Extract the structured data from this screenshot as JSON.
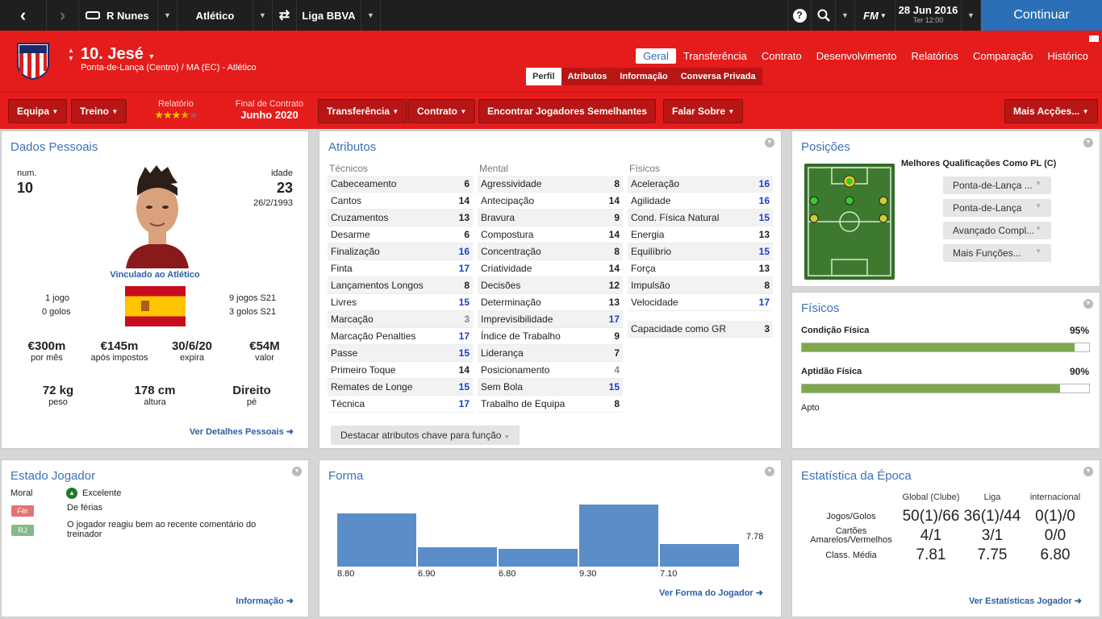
{
  "topbar": {
    "manager": "R Nunes",
    "club": "Atlético",
    "competition": "Liga BBVA",
    "fm": "FM",
    "date": "28 Jun 2016",
    "time": "Ter 12:00",
    "continue": "Continuar"
  },
  "header": {
    "name": "10. Jesé",
    "position": "Ponta-de-Lança (Centro) / MA (EC) - Atlético",
    "tabs": [
      "Geral",
      "Transferência",
      "Contrato",
      "Desenvolvimento",
      "Relatórios",
      "Comparação",
      "Histórico"
    ],
    "subtabs": [
      "Perfil",
      "Atributos",
      "Informação",
      "Conversa Privada"
    ]
  },
  "actions": {
    "equipa": "Equipa",
    "treino": "Treino",
    "relatorio_label": "Relatório",
    "relatorio_stars": "★★★★★",
    "contract_label": "Final de Contrato",
    "contract_value": "Junho 2020",
    "transferencia": "Transferência",
    "contrato": "Contrato",
    "semelhantes": "Encontrar Jogadores Semelhantes",
    "falar": "Falar Sobre",
    "mais": "Mais Acções..."
  },
  "personal": {
    "title": "Dados Pessoais",
    "num_label": "num.",
    "num": "10",
    "age_label": "idade",
    "age": "23",
    "dob": "26/2/1993",
    "loan": "Vinculado ao Atlético",
    "games": "1 jogo",
    "goals": "0 golos",
    "u21_games": "9 jogos S21",
    "u21_goals": "3 golos S21",
    "wage": "€300m",
    "wage_l": "por mês",
    "after_tax": "€145m",
    "after_tax_l": "após impostos",
    "expires": "30/6/20",
    "expires_l": "expira",
    "value": "€54M",
    "value_l": "valor",
    "weight": "72 kg",
    "weight_l": "peso",
    "height": "178 cm",
    "height_l": "altura",
    "foot": "Direito",
    "foot_l": "pé",
    "link": "Ver Detalhes Pessoais"
  },
  "attributes": {
    "title": "Atributos",
    "tech_h": "Técnicos",
    "mental_h": "Mental",
    "phys_h": "Físicos",
    "technical": [
      [
        "Cabeceamento",
        "6"
      ],
      [
        "Cantos",
        "14"
      ],
      [
        "Cruzamentos",
        "13"
      ],
      [
        "Desarme",
        "6"
      ],
      [
        "Finalização",
        "16"
      ],
      [
        "Finta",
        "17"
      ],
      [
        "Lançamentos Longos",
        "8"
      ],
      [
        "Livres",
        "15"
      ],
      [
        "Marcação",
        "3"
      ],
      [
        "Marcação Penalties",
        "17"
      ],
      [
        "Passe",
        "15"
      ],
      [
        "Primeiro Toque",
        "14"
      ],
      [
        "Remates de Longe",
        "15"
      ],
      [
        "Técnica",
        "17"
      ]
    ],
    "mental": [
      [
        "Agressividade",
        "8"
      ],
      [
        "Antecipação",
        "14"
      ],
      [
        "Bravura",
        "9"
      ],
      [
        "Compostura",
        "14"
      ],
      [
        "Concentração",
        "8"
      ],
      [
        "Criatividade",
        "14"
      ],
      [
        "Decisões",
        "12"
      ],
      [
        "Determinação",
        "13"
      ],
      [
        "Imprevisibilidade",
        "17"
      ],
      [
        "Índice de Trabalho",
        "9"
      ],
      [
        "Liderança",
        "7"
      ],
      [
        "Posicionamento",
        "4"
      ],
      [
        "Sem Bola",
        "15"
      ],
      [
        "Trabalho de Equipa",
        "8"
      ]
    ],
    "physical": [
      [
        "Aceleração",
        "16"
      ],
      [
        "Agilidade",
        "16"
      ],
      [
        "Cond. Física Natural",
        "15"
      ],
      [
        "Energia",
        "13"
      ],
      [
        "Equilíbrio",
        "15"
      ],
      [
        "Força",
        "13"
      ],
      [
        "Impulsão",
        "8"
      ],
      [
        "Velocidade",
        "17"
      ]
    ],
    "gk_label": "Capacidade como GR",
    "gk": "3",
    "highlight_btn": "Destacar atributos chave para função"
  },
  "positions": {
    "title": "Posições",
    "best": "Melhores Qualificações Como PL (C)",
    "roles": [
      "Ponta-de-Lança ...",
      "Ponta-de-Lança",
      "Avançado Compl...",
      "Mais Funções..."
    ]
  },
  "fitness": {
    "title": "Físicos",
    "cond_label": "Condição Física",
    "cond": "95%",
    "cond_frac": 0.95,
    "apt_label": "Aptidão Física",
    "apt": "90%",
    "apt_frac": 0.9,
    "status": "Apto"
  },
  "state": {
    "title": "Estado Jogador",
    "moral_label": "Moral",
    "moral": "Excelente",
    "fer": "Fér",
    "fer_text": "De férias",
    "rj": "RJ",
    "rj_text": "O jogador reagiu bem ao recente comentário do treinador",
    "link": "Informação"
  },
  "form": {
    "title": "Forma",
    "avg": "7.78",
    "link": "Ver Forma do Jogador"
  },
  "chart_data": {
    "type": "bar",
    "categories": [
      "1",
      "2",
      "3",
      "4",
      "5"
    ],
    "values": [
      8.8,
      6.9,
      6.8,
      9.3,
      7.1
    ],
    "labels": [
      "8.80",
      "6.90",
      "6.80",
      "9.30",
      "7.10"
    ]
  },
  "season": {
    "title": "Estatística da Época",
    "cols": [
      "Global (Clube)",
      "Liga",
      "internacional"
    ],
    "rows": [
      {
        "label": "Jogos/Golos",
        "vals": [
          "50(1)/66",
          "36(1)/44",
          "0(1)/0"
        ]
      },
      {
        "label": "Cartões Amarelos/Vermelhos",
        "vals": [
          "4/1",
          "3/1",
          "0/0"
        ]
      },
      {
        "label": "Class. Média",
        "vals": [
          "7.81",
          "7.75",
          "6.80"
        ]
      }
    ],
    "link": "Ver Estatísticas Jogador"
  }
}
